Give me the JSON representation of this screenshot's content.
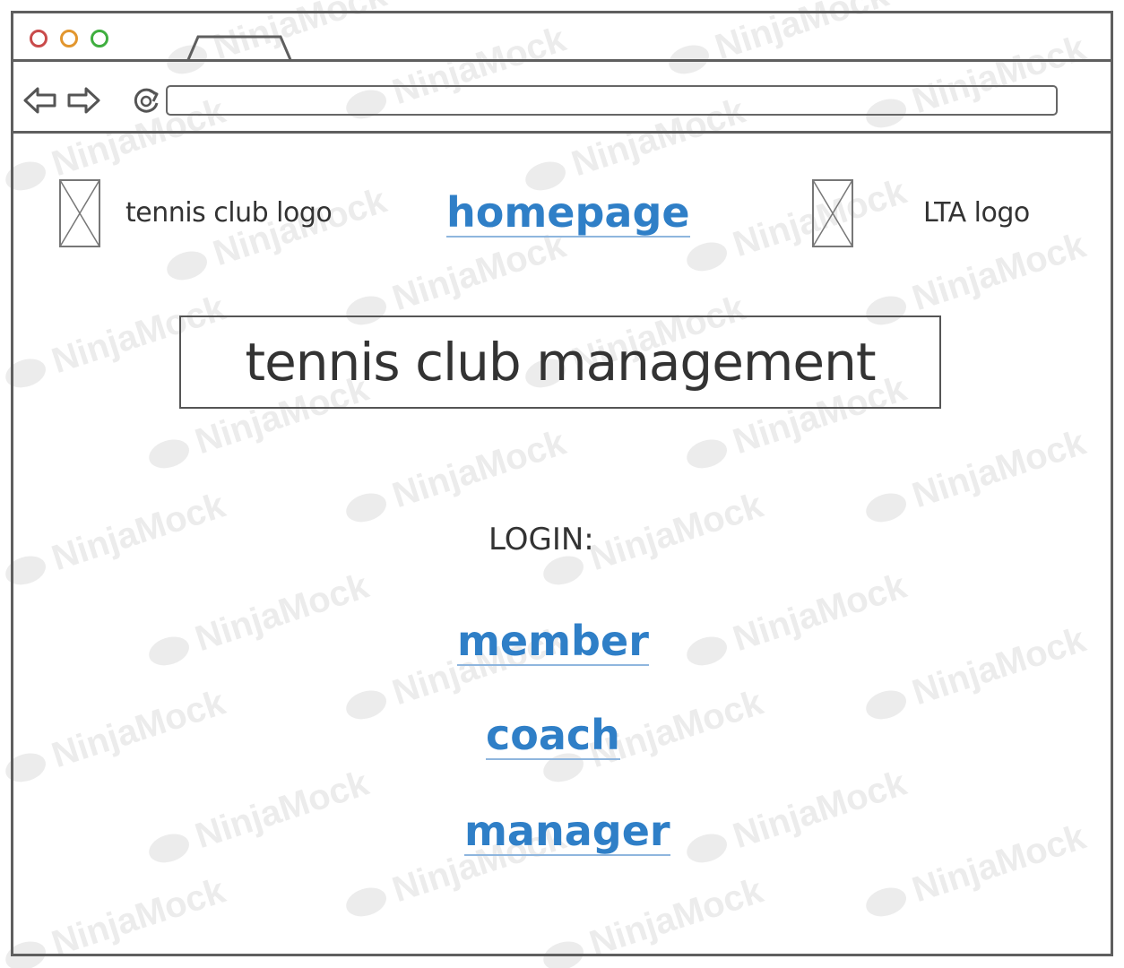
{
  "browser": {
    "url": "",
    "icons": [
      "back-arrow-icon",
      "forward-arrow-icon",
      "refresh-icon"
    ]
  },
  "header": {
    "left_logo_label": "tennis club logo",
    "right_logo_label": "LTA logo",
    "home_link": "homepage"
  },
  "main": {
    "title": "tennis club management",
    "login_label": "LOGIN:",
    "login_options": [
      "member",
      "coach",
      "manager"
    ]
  },
  "watermark_text": "NinjaMock",
  "colors": {
    "link": "#2f7fc7",
    "border": "#5f5f5f",
    "dot_red": "#c94b4b",
    "dot_orange": "#e2962e",
    "dot_green": "#3fae3f"
  }
}
